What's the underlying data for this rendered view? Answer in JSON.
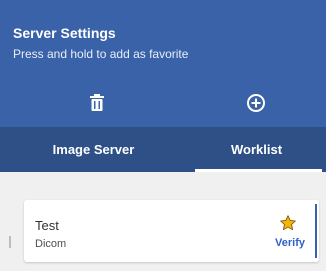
{
  "header": {
    "title": "Server Settings",
    "subtitle": "Press and hold to add as favorite",
    "background_color": "#3a62a8",
    "icons": [
      {
        "name": "trash-icon"
      },
      {
        "name": "add-circle-icon"
      }
    ]
  },
  "tabs": [
    {
      "label": "Image Server",
      "selected": false
    },
    {
      "label": "Worklist",
      "selected": true
    }
  ],
  "tabs_background_color": "#2e5087",
  "servers": [
    {
      "name": "Test",
      "type": "Dicom",
      "favorite": true,
      "favorite_icon": "star-icon",
      "star_color": "#f2b705",
      "action_label": "Verify",
      "action_color": "#2d62c9"
    }
  ]
}
